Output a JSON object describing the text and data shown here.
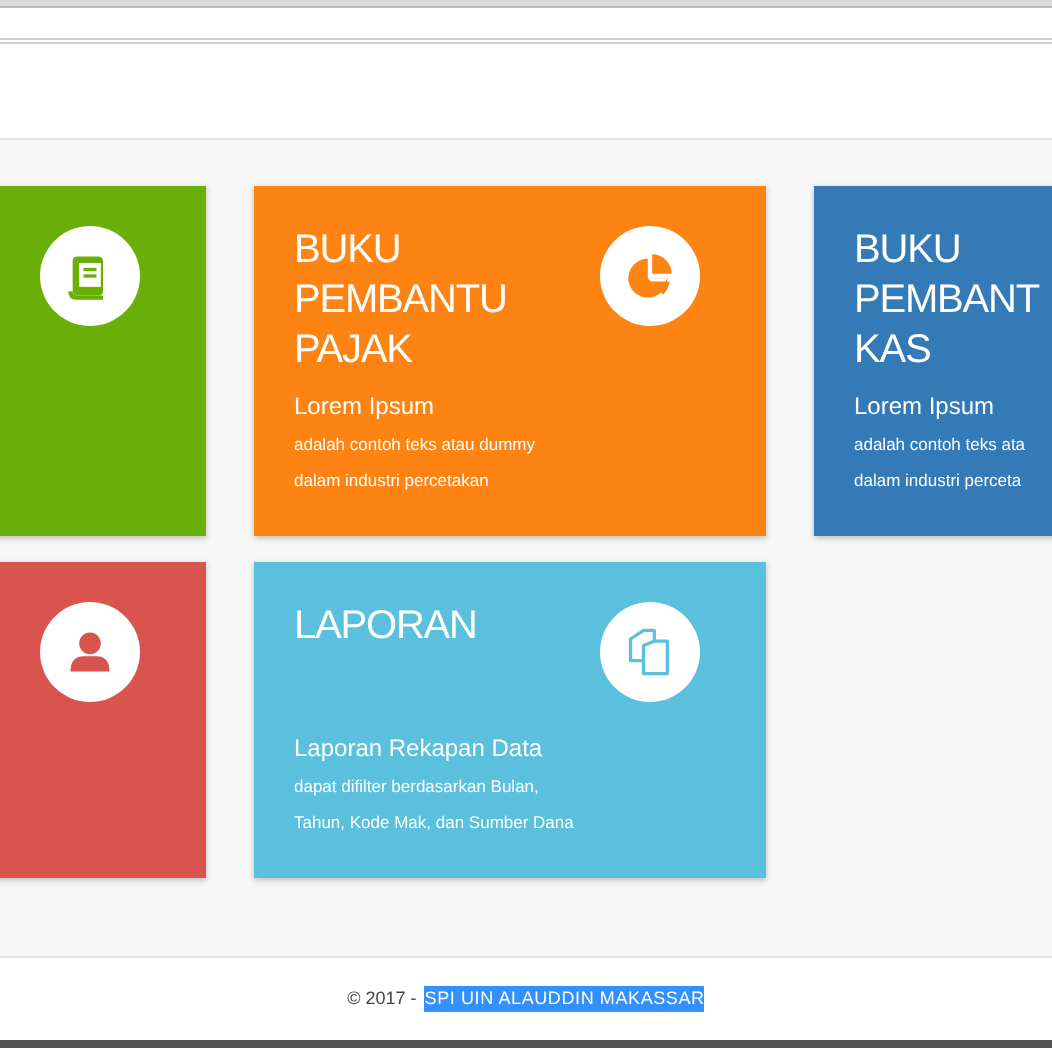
{
  "rows": [
    [
      {
        "color": "#6aaf08"
      },
      {
        "title": [
          "BUKU",
          "PEMBANTU",
          "PAJAK"
        ],
        "subtitle": "Lorem Ipsum",
        "description": [
          "adalah contoh teks atau dummy",
          "dalam industri percetakan"
        ],
        "color": "#fd8412"
      },
      {
        "title": [
          "BUKU",
          "PEMBANT",
          "KAS"
        ],
        "subtitle": "Lorem Ipsum",
        "description": [
          "adalah contoh teks ata",
          "dalam industri perceta"
        ],
        "color": "#337ab7"
      }
    ],
    [
      {
        "color": "#d9534f"
      },
      {
        "title": [
          "LAPORAN"
        ],
        "subtitle": "Laporan Rekapan Data",
        "description": [
          "dapat difilter berdasarkan Bulan,",
          "Tahun, Kode Mak, dan Sumber Dana"
        ],
        "color": "#5bc0de"
      }
    ]
  ],
  "footer": {
    "text": "© 2017 -",
    "link": {
      "label": "SPI UIN ALAUDDIN MAKASSAR",
      "selected": true
    }
  }
}
